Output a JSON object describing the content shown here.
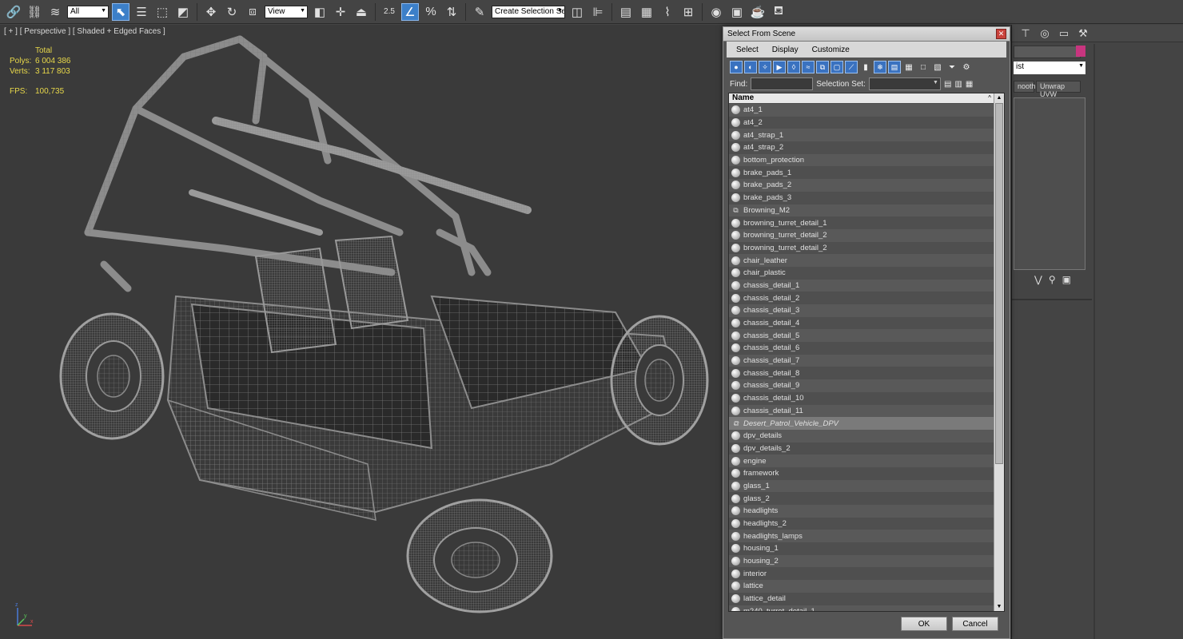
{
  "toolbar": {
    "filter_select": "All",
    "ref_coord_select": "View",
    "selection_set_select": "Create Selection Se",
    "snap_label": "2.5",
    "angle_label": "%"
  },
  "viewport": {
    "label": "[ + ] [ Perspective ] [ Shaded + Edged Faces ]",
    "stats": {
      "total_label": "Total",
      "polys_label": "Polys:",
      "polys_value": "6 004 386",
      "verts_label": "Verts:",
      "verts_value": "3 117 803",
      "fps_label": "FPS:",
      "fps_value": "100,735"
    },
    "axis": {
      "x": "x",
      "y": "y",
      "z": "z"
    }
  },
  "command_panel": {
    "list_select": "ist",
    "btn_smooth": "nooth",
    "btn_unwrap": "Unwrap UVW",
    "accent_color": "#c8357f"
  },
  "dialog": {
    "title": "Select From Scene",
    "close_glyph": "✕",
    "menu": [
      "Select",
      "Display",
      "Customize"
    ],
    "find_label": "Find:",
    "selection_set_label": "Selection Set:",
    "column_name": "Name",
    "sort_glyph": "^",
    "items": [
      {
        "name": "at4_1",
        "type": "object"
      },
      {
        "name": "at4_2",
        "type": "object"
      },
      {
        "name": "at4_strap_1",
        "type": "object"
      },
      {
        "name": "at4_strap_2",
        "type": "object"
      },
      {
        "name": "bottom_protection",
        "type": "object"
      },
      {
        "name": "brake_pads_1",
        "type": "object"
      },
      {
        "name": "brake_pads_2",
        "type": "object"
      },
      {
        "name": "brake_pads_3",
        "type": "object"
      },
      {
        "name": "Browning_M2",
        "type": "group"
      },
      {
        "name": "browning_turret_detail_1",
        "type": "object"
      },
      {
        "name": "browning_turret_detail_2",
        "type": "object"
      },
      {
        "name": "browning_turret_detail_2",
        "type": "object"
      },
      {
        "name": "chair_leather",
        "type": "object"
      },
      {
        "name": "chair_plastic",
        "type": "object"
      },
      {
        "name": "chassis_detail_1",
        "type": "object"
      },
      {
        "name": "chassis_detail_2",
        "type": "object"
      },
      {
        "name": "chassis_detail_3",
        "type": "object"
      },
      {
        "name": "chassis_detail_4",
        "type": "object"
      },
      {
        "name": "chassis_detail_5",
        "type": "object"
      },
      {
        "name": "chassis_detail_6",
        "type": "object"
      },
      {
        "name": "chassis_detail_7",
        "type": "object"
      },
      {
        "name": "chassis_detail_8",
        "type": "object"
      },
      {
        "name": "chassis_detail_9",
        "type": "object"
      },
      {
        "name": "chassis_detail_10",
        "type": "object"
      },
      {
        "name": "chassis_detail_11",
        "type": "object"
      },
      {
        "name": "Desert_Patrol_Vehicle_DPV",
        "type": "group",
        "selected": true
      },
      {
        "name": "dpv_details",
        "type": "object"
      },
      {
        "name": "dpv_details_2",
        "type": "object"
      },
      {
        "name": "engine",
        "type": "object"
      },
      {
        "name": "framework",
        "type": "object"
      },
      {
        "name": "glass_1",
        "type": "object"
      },
      {
        "name": "glass_2",
        "type": "object"
      },
      {
        "name": "headlights",
        "type": "object"
      },
      {
        "name": "headlights_2",
        "type": "object"
      },
      {
        "name": "headlights_lamps",
        "type": "object"
      },
      {
        "name": "housing_1",
        "type": "object"
      },
      {
        "name": "housing_2",
        "type": "object"
      },
      {
        "name": "interior",
        "type": "object"
      },
      {
        "name": "lattice",
        "type": "object"
      },
      {
        "name": "lattice_detail",
        "type": "object"
      },
      {
        "name": "m240_turret_detail_1",
        "type": "object"
      }
    ],
    "ok_label": "OK",
    "cancel_label": "Cancel"
  }
}
